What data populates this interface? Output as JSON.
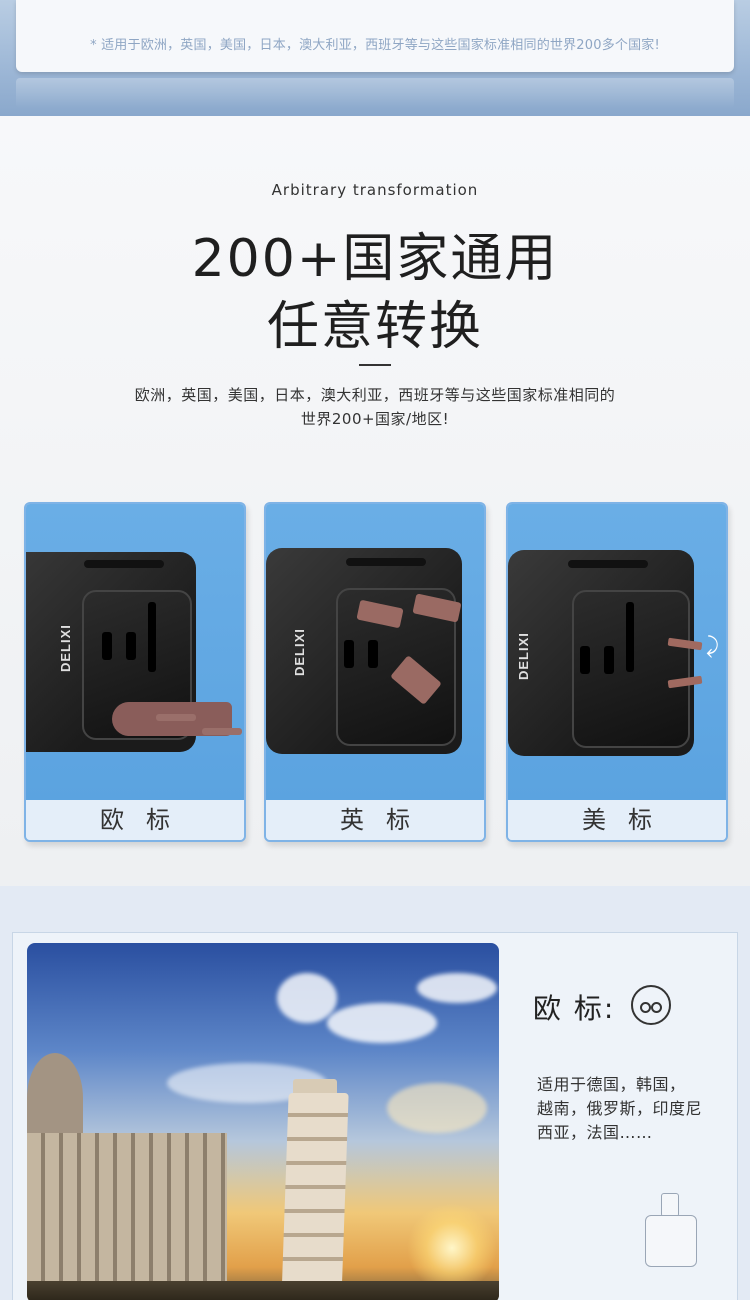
{
  "top": {
    "note": "* 适用于欧洲，英国，美国，日本，澳大利亚，西班牙等与这些国家标准相同的世界200多个国家!"
  },
  "headline_section": {
    "subtitle_en": "Arbitrary transformation",
    "headline_line1": "200+国家通用",
    "headline_line2": "任意转换",
    "desc_line1": "欧洲，英国，美国，日本，澳大利亚，西班牙等与这些国家标准相同的",
    "desc_line2": "世界200+国家/地区!"
  },
  "plug_cards": [
    {
      "label": "欧标",
      "brand": "DELIXI"
    },
    {
      "label": "英标",
      "brand": "DELIXI"
    },
    {
      "label": "美标",
      "brand": "DELIXI"
    }
  ],
  "feature": {
    "title": "欧 标:",
    "countries_line1": "适用于德国，韩国，",
    "countries_line2": "越南，俄罗斯，印度尼",
    "countries_line3": "西亚，法国……"
  },
  "colors": {
    "card_photo_bg": "#5ba3e0",
    "card_label_bg": "#e4eef9",
    "top_band": "#9db7d6"
  },
  "icons": [
    "eu-socket-icon",
    "rotate-arrows-icon",
    "adapter-outline-icon"
  ]
}
